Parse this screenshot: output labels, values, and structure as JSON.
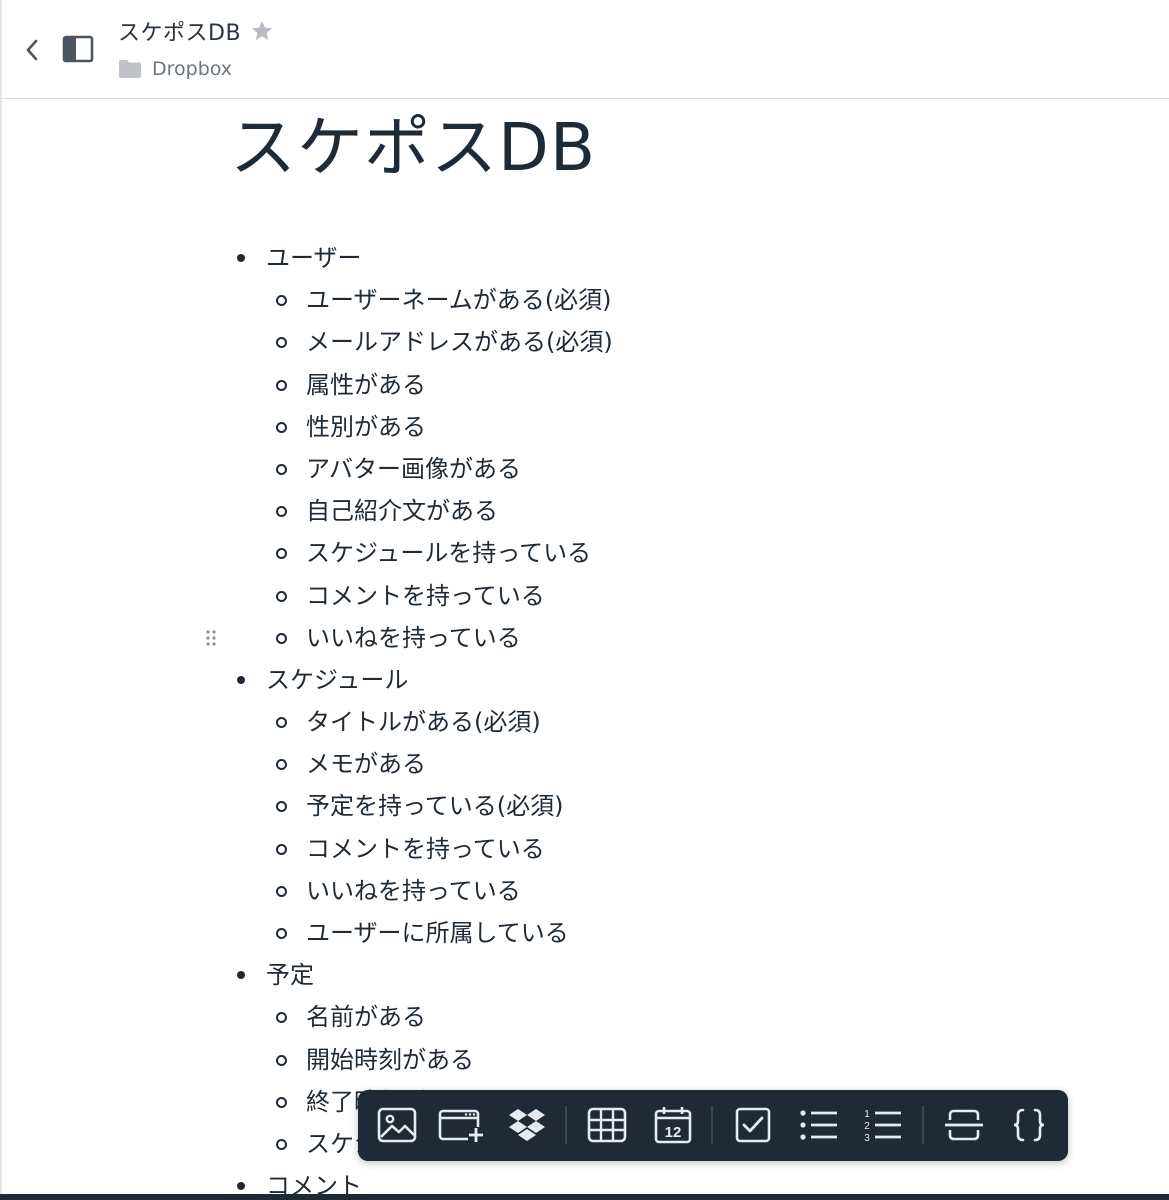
{
  "header": {
    "doc_title": "スケポスDB",
    "folder_name": "Dropbox",
    "icons": {
      "back": "chevron-left-icon",
      "sidebar": "sidebar-toggle-icon",
      "star": "star-icon",
      "folder": "folder-icon"
    }
  },
  "document": {
    "heading": "スケポスDB",
    "list": [
      {
        "label": "ユーザー",
        "children": [
          "ユーザーネームがある(必須)",
          "メールアドレスがある(必須)",
          "属性がある",
          "性別がある",
          "アバター画像がある",
          "自己紹介文がある",
          "スケジュールを持っている",
          "コメントを持っている",
          "いいねを持っている"
        ]
      },
      {
        "label": "スケジュール",
        "children": [
          "タイトルがある(必須)",
          "メモがある",
          "予定を持っている(必須)",
          "コメントを持っている",
          "いいねを持っている",
          "ユーザーに所属している"
        ]
      },
      {
        "label": "予定",
        "children": [
          "名前がある",
          "開始時刻がある",
          "終了時刻がある",
          "スケジュールに所属している"
        ]
      },
      {
        "label": "コメント",
        "children": []
      }
    ]
  },
  "toolbar": {
    "buttons": [
      "image-icon",
      "embed-add-icon",
      "dropbox-icon",
      "table-icon",
      "calendar-date-icon",
      "checkbox-icon",
      "bulleted-list-icon",
      "numbered-list-icon",
      "divider-icon",
      "code-block-icon"
    ],
    "calendar_day": "12"
  },
  "colors": {
    "text": "#1e2a36",
    "toolbar_bg": "#1f2a36",
    "muted": "#6c7580",
    "star": "#b8bcc2"
  }
}
